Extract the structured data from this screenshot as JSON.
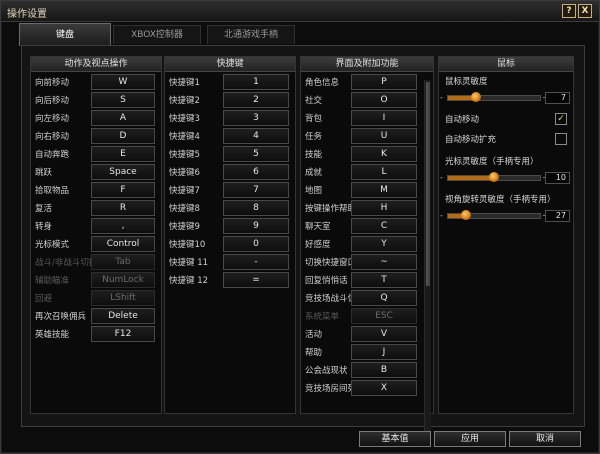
{
  "window": {
    "title": "操作设置"
  },
  "titlebar_buttons": {
    "help": "?",
    "close": "X"
  },
  "tabs": [
    {
      "label": "键盘",
      "active": true
    },
    {
      "label": "XBOX控制器",
      "active": false
    },
    {
      "label": "北通游戏手柄",
      "active": false
    }
  ],
  "actions_panel": {
    "header": "动作及视点操作",
    "rows": [
      {
        "label": "向前移动",
        "key": "W",
        "disabled": false
      },
      {
        "label": "向后移动",
        "key": "S",
        "disabled": false
      },
      {
        "label": "向左移动",
        "key": "A",
        "disabled": false
      },
      {
        "label": "向右移动",
        "key": "D",
        "disabled": false
      },
      {
        "label": "自动奔跑",
        "key": "E",
        "disabled": false
      },
      {
        "label": "跳跃",
        "key": "Space",
        "disabled": false
      },
      {
        "label": "拾取物品",
        "key": "F",
        "disabled": false
      },
      {
        "label": "复活",
        "key": "R",
        "disabled": false
      },
      {
        "label": "转身",
        "key": ",",
        "disabled": false
      },
      {
        "label": "光标模式",
        "key": "Control",
        "disabled": false
      },
      {
        "label": "战斗/非战斗切换",
        "key": "Tab",
        "disabled": true
      },
      {
        "label": "辅助瞄准",
        "key": "NumLock",
        "disabled": true
      },
      {
        "label": "回避",
        "key": "LShift",
        "disabled": true
      },
      {
        "label": "再次召唤佣兵",
        "key": "Delete",
        "disabled": false
      },
      {
        "label": "英雄技能",
        "key": "F12",
        "disabled": false
      }
    ]
  },
  "hotkeys_panel": {
    "header": "快捷键",
    "rows": [
      {
        "label": "快捷键1",
        "key": "1"
      },
      {
        "label": "快捷键2",
        "key": "2"
      },
      {
        "label": "快捷键3",
        "key": "3"
      },
      {
        "label": "快捷键4",
        "key": "4"
      },
      {
        "label": "快捷键5",
        "key": "5"
      },
      {
        "label": "快捷键6",
        "key": "6"
      },
      {
        "label": "快捷键7",
        "key": "7"
      },
      {
        "label": "快捷键8",
        "key": "8"
      },
      {
        "label": "快捷键9",
        "key": "9"
      },
      {
        "label": "快捷键10",
        "key": "0"
      },
      {
        "label": "快捷键 11",
        "key": "-"
      },
      {
        "label": "快捷键 12",
        "key": "="
      }
    ]
  },
  "interface_panel": {
    "header": "界面及附加功能",
    "rows": [
      {
        "label": "角色信息",
        "key": "P",
        "disabled": false
      },
      {
        "label": "社交",
        "key": "O",
        "disabled": false
      },
      {
        "label": "背包",
        "key": "I",
        "disabled": false
      },
      {
        "label": "任务",
        "key": "U",
        "disabled": false
      },
      {
        "label": "技能",
        "key": "K",
        "disabled": false
      },
      {
        "label": "成就",
        "key": "L",
        "disabled": false
      },
      {
        "label": "地图",
        "key": "M",
        "disabled": false
      },
      {
        "label": "按键操作帮助",
        "key": "H",
        "disabled": false
      },
      {
        "label": "聊天室",
        "key": "C",
        "disabled": false
      },
      {
        "label": "好感度",
        "key": "Y",
        "disabled": false
      },
      {
        "label": "切换快捷窗口",
        "key": "~",
        "disabled": false
      },
      {
        "label": "回复悄悄话",
        "key": "T",
        "disabled": false
      },
      {
        "label": "竞技场战斗信息",
        "key": "Q",
        "disabled": false
      },
      {
        "label": "系统菜单",
        "key": "ESC",
        "disabled": true
      },
      {
        "label": "活动",
        "key": "V",
        "disabled": false
      },
      {
        "label": "帮助",
        "key": "J",
        "disabled": false
      },
      {
        "label": "公会战现状",
        "key": "B",
        "disabled": false
      },
      {
        "label": "竞技场房间列表",
        "key": "X",
        "disabled": false
      }
    ]
  },
  "mouse_panel": {
    "header": "鼠标",
    "sensitivity": {
      "label": "鼠标灵敏度",
      "value": "7",
      "fraction": 0.3,
      "min_sign": "-",
      "max_sign": "+"
    },
    "auto_move": {
      "label": "自动移动",
      "checked": true,
      "mark": "✓"
    },
    "auto_move_ext": {
      "label": "自动移动扩充",
      "checked": false,
      "mark": ""
    },
    "cursor_sensitivity": {
      "label": "光标灵敏度（手柄专用）",
      "value": "10",
      "fraction": 0.5,
      "min_sign": "-",
      "max_sign": "+"
    },
    "camera_sensitivity": {
      "label": "视角旋转灵敏度（手柄专用）",
      "value": "27",
      "fraction": 0.2,
      "min_sign": "-",
      "max_sign": "+"
    }
  },
  "buttons": {
    "default": "基本值",
    "apply": "应用",
    "cancel": "取消"
  },
  "colors": {
    "accent": "#d47a10",
    "window_bg": "#0c0c0c",
    "panel_border": "#343434",
    "title_text": "#e0d6b8"
  }
}
